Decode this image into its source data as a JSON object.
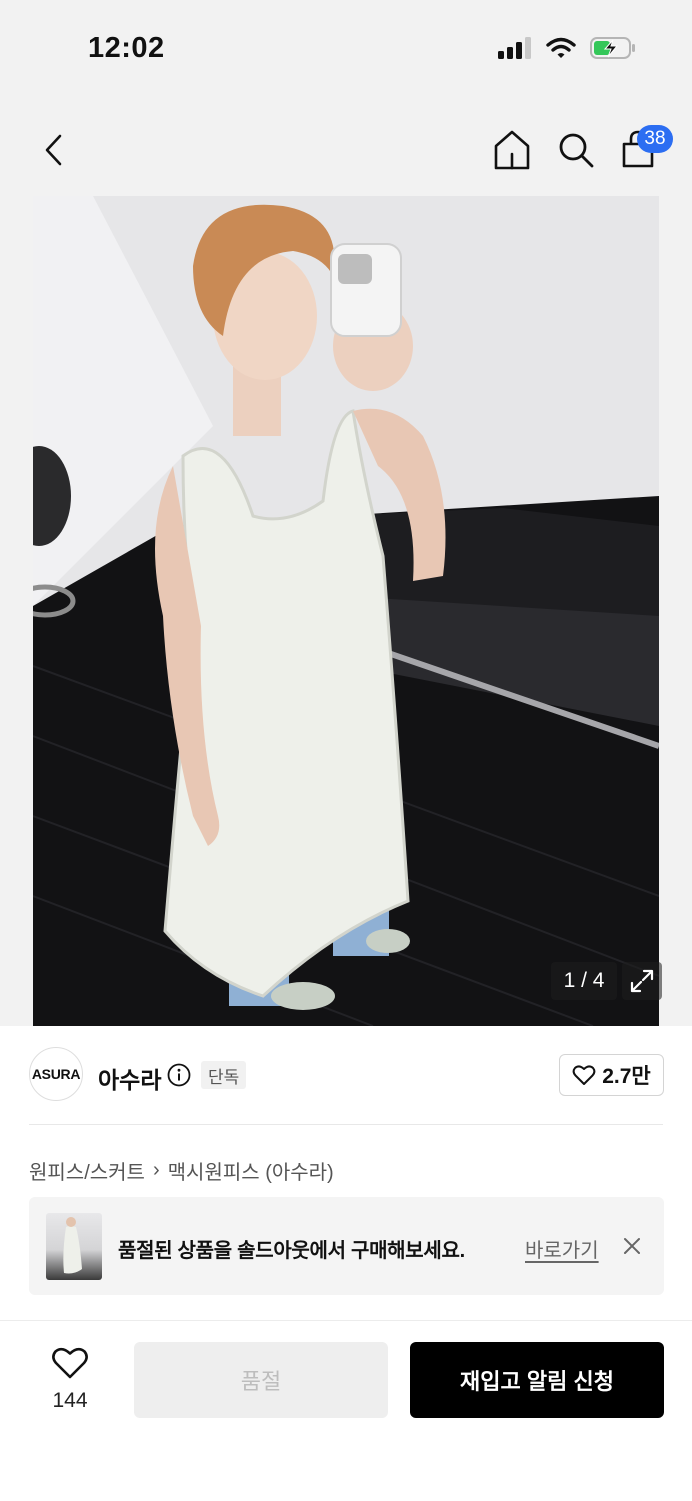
{
  "status_bar": {
    "time": "12:02"
  },
  "nav": {
    "cart_count": "38"
  },
  "gallery": {
    "counter": "1 / 4"
  },
  "brand": {
    "logo_text": "ASURA",
    "name": "아수라",
    "tag": "단독",
    "likes": "2.7만"
  },
  "breadcrumb": {
    "category": "원피스/스커트",
    "separator": "›",
    "subcategory": "맥시원피스 (아수라)"
  },
  "banner": {
    "text": "품절된 상품을 솔드아웃에서 구매해보세요.",
    "link": "바로가기"
  },
  "peek": {
    "text": ""
  },
  "bottom": {
    "wish_count": "144",
    "soldout_label": "품절",
    "restock_label": "재입고 알림 신청"
  },
  "colors": {
    "badge": "#2c6ef2",
    "primary_button": "#000000",
    "battery": "#34c759"
  },
  "icons": [
    "signal-icon",
    "wifi-icon",
    "battery-icon",
    "back-icon",
    "home-icon",
    "search-icon",
    "bag-icon",
    "info-icon",
    "heart-icon",
    "expand-icon",
    "close-icon"
  ]
}
